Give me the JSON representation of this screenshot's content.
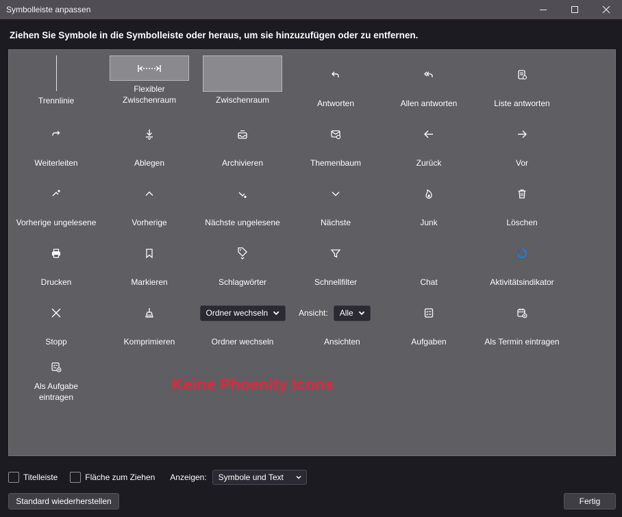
{
  "window": {
    "title": "Symbolleiste anpassen",
    "controls": [
      "minimize-icon",
      "maximize-icon",
      "close-icon"
    ]
  },
  "instruction": "Ziehen Sie Symbole in die Symbolleiste oder heraus, um sie hinzuzufügen oder zu entfernen.",
  "palette": {
    "row1": {
      "trennlinie": "Trennlinie",
      "flex_line1": "Flexibler",
      "flex_line2": "Zwischenraum",
      "zwischenraum": "Zwischenraum",
      "antworten": "Antworten",
      "allen_antworten": "Allen antworten",
      "liste_antworten": "Liste antworten"
    },
    "row2": {
      "weiterleiten": "Weiterleiten",
      "ablegen": "Ablegen",
      "archivieren": "Archivieren",
      "themenbaum": "Themenbaum",
      "zurueck": "Zurück",
      "vor": "Vor"
    },
    "row3": {
      "vorherige_ungelesene": "Vorherige ungelesene",
      "vorherige": "Vorherige",
      "naechste_ungelesene": "Nächste ungelesene",
      "naechste": "Nächste",
      "junk": "Junk",
      "loeschen": "Löschen"
    },
    "row4": {
      "drucken": "Drucken",
      "markieren": "Markieren",
      "schlagwoerter": "Schlagwörter",
      "schnellfilter": "Schnellfilter",
      "chat": "Chat",
      "aktivitaetsindikator": "Aktivitätsindikator"
    },
    "row5": {
      "stopp": "Stopp",
      "komprimieren": "Komprimieren",
      "ordner_dropdown": "Ordner wechseln",
      "ordner_wechseln": "Ordner wechseln",
      "ansicht_label": "Ansicht:",
      "ansicht_value": "Alle",
      "ansichten": "Ansichten",
      "aufgaben": "Aufgaben",
      "als_termin": "Als Termin eintragen"
    },
    "row6": {
      "als_aufgabe_line1": "Als Aufgabe",
      "als_aufgabe_line2": "eintragen"
    },
    "watermark": "Keine Phoenity Icons"
  },
  "footer": {
    "titelleiste": "Titelleiste",
    "flaeche": "Fläche zum Ziehen",
    "anzeigen_label": "Anzeigen:",
    "anzeigen_value": "Symbole und Text",
    "restore_button": "Standard wiederherstellen",
    "done_button": "Fertig"
  },
  "colors": {
    "accent_spinner": "#0a84ff",
    "watermark": "#e0283a",
    "palette_bg": "#5f5e62"
  }
}
